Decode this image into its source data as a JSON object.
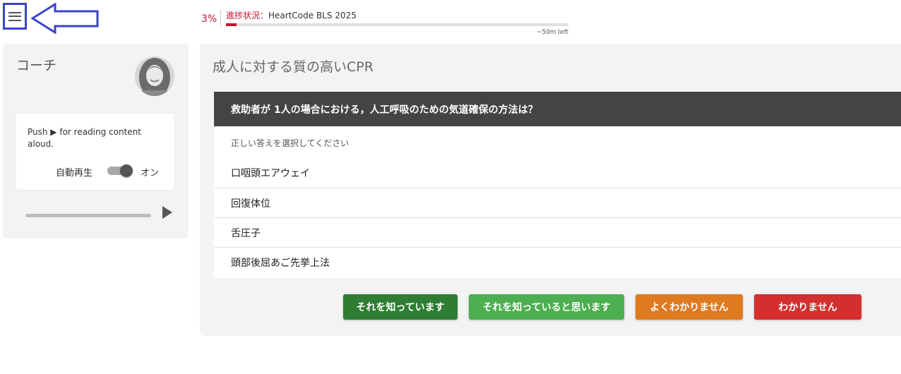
{
  "header": {
    "progress_percent_label": "3%",
    "progress_fraction": 0.03,
    "progress_keyword": "進捗状況：",
    "course_name": "HeartCode BLS 2025",
    "time_left": "~50m left"
  },
  "coach": {
    "title": "コーチ",
    "instruction": "Push ▶ for reading content aloud.",
    "autoplay_label": "自動再生",
    "autoplay_state": "オン"
  },
  "question": {
    "section_title": "成人に対する質の高いCPR",
    "text": "救助者が 1人の場合における，人工呼吸のための気道確保の方法は？",
    "instruction": "正しい答えを選択してください",
    "options": [
      "口咽頭エアウェイ",
      "回復体位",
      "舌圧子",
      "頭部後屈あご先挙上法"
    ]
  },
  "buttons": {
    "know": "それを知っています",
    "think_know": "それを知っていると思います",
    "unsure": "よくわかりません",
    "dont_know": "わかりません"
  },
  "colors": {
    "accent_red": "#c8102e",
    "know": "#2e7d32",
    "think_know": "#4caf50",
    "unsure": "#e07a1f",
    "dont_know": "#d32f2f",
    "annotation_blue": "#3a44c8"
  }
}
